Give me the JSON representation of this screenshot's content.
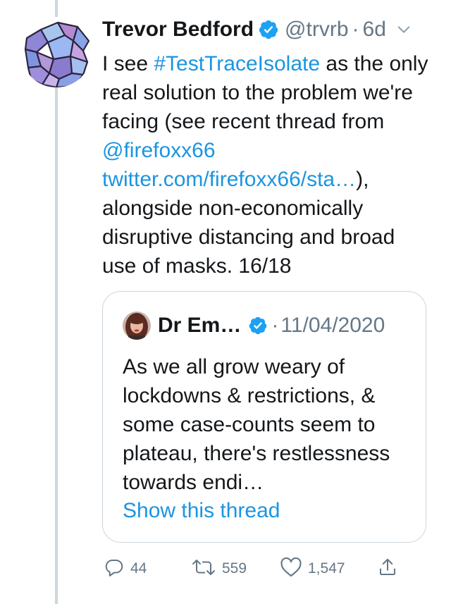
{
  "tweet": {
    "author_name": "Trevor Bedford",
    "handle": "@trvrb",
    "separator": "·",
    "time": "6d",
    "body": {
      "part1": "I see ",
      "hashtag": "#TestTraceIsolate",
      "part2": " as the only real solution to the problem we're facing (see recent thread from ",
      "mention": "@firefoxx66",
      "link": "twitter.com/firefoxx66/sta…",
      "part3": "), alongside non-economically disruptive distancing and broad use of masks. 16/18"
    }
  },
  "quote": {
    "author_name": "Dr Em…",
    "separator": "·",
    "date": "11/04/2020",
    "text": "As we all grow weary of lockdowns & restrictions, & some case-counts seem to plateau, there's restlessness towards endi…",
    "show_thread_label": "Show this thread"
  },
  "actions": {
    "replies": "44",
    "retweets": "559",
    "likes": "1,547"
  },
  "colors": {
    "link": "#1b95e0",
    "secondary_text": "#657786",
    "border": "#ccd6dd",
    "verified": "#1da1f2"
  },
  "icons": {
    "verified": "verified-badge-icon",
    "caret": "chevron-down-icon",
    "reply": "reply-icon",
    "retweet": "retweet-icon",
    "like": "heart-icon",
    "share": "share-icon"
  }
}
